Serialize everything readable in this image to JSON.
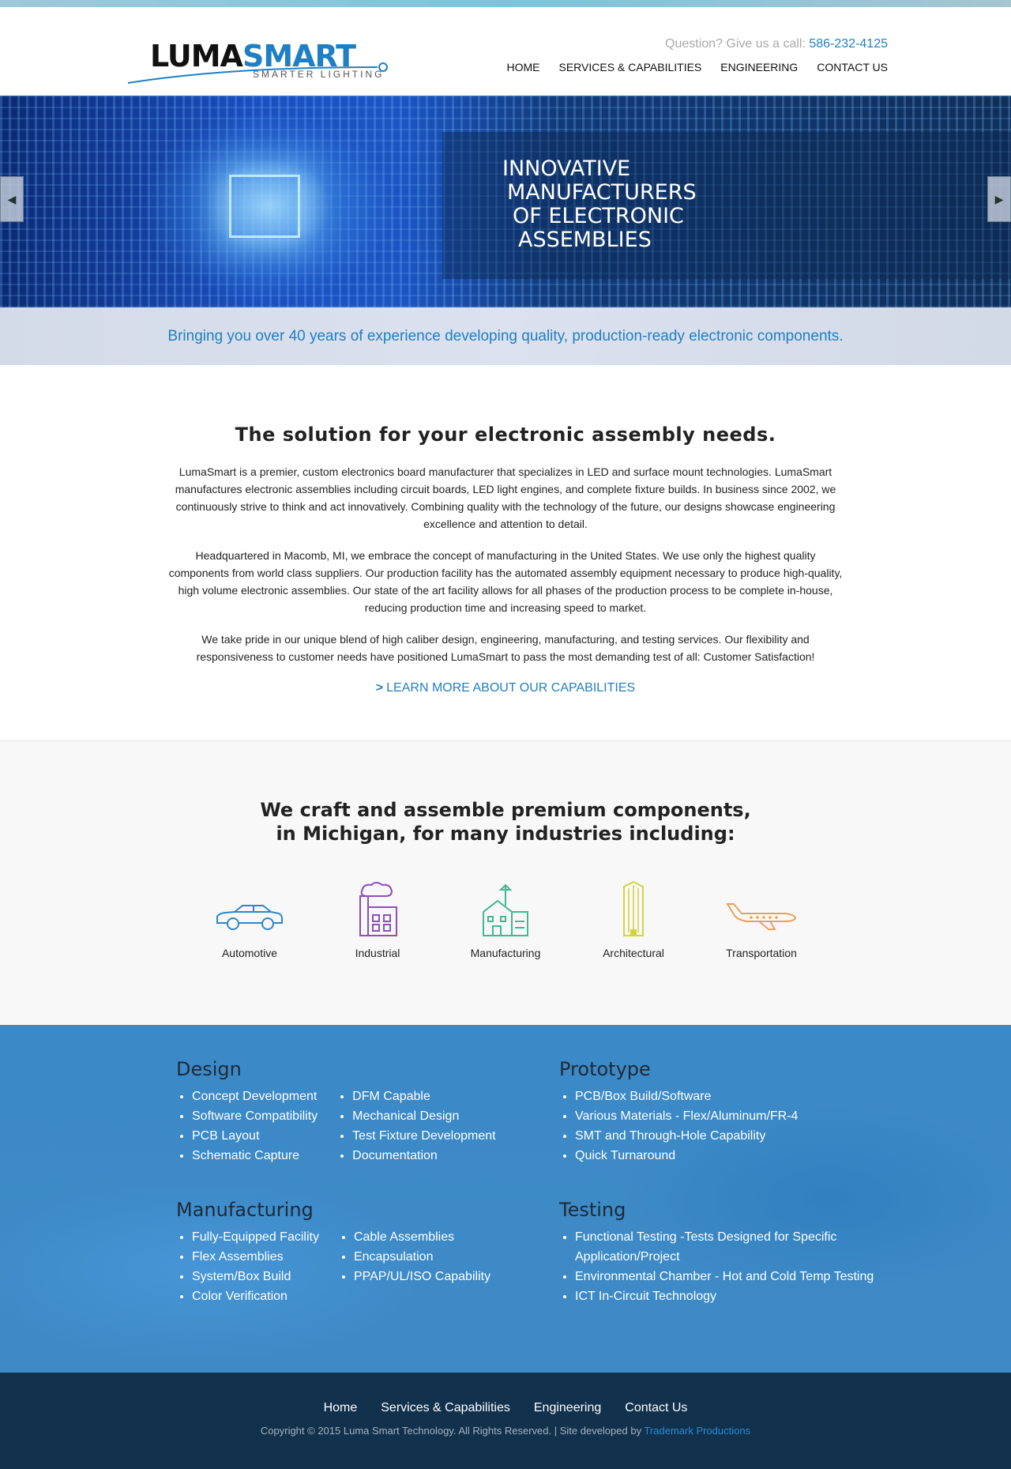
{
  "header": {
    "logo": {
      "luma": "LUMA",
      "smart": "SMART",
      "tagline": "SMARTER LIGHTING"
    },
    "phone_prefix": "Question? Give us a call:",
    "phone_number": "586-232-4125",
    "nav": [
      "HOME",
      "SERVICES & CAPABILITIES",
      "ENGINEERING",
      "CONTACT US"
    ]
  },
  "hero": {
    "lines": [
      "INNOVATIVE",
      "MANUFACTURERS",
      "OF ELECTRONIC",
      "ASSEMBLIES"
    ],
    "prev_icon": "triangle-left-icon",
    "next_icon": "triangle-right-icon"
  },
  "tagline": "Bringing you over 40 years of experience developing quality, production-ready electronic components.",
  "intro": {
    "heading": "The solution for your electronic assembly needs.",
    "paragraphs": [
      "LumaSmart is a premier, custom electronics board manufacturer that specializes in LED and surface mount technologies. LumaSmart manufactures electronic assemblies including circuit boards, LED light engines, and complete fixture builds. In business since 2002, we continuously strive to think and act innovatively. Combining quality with the technology of the future, our designs showcase engineering excellence and attention to detail.",
      "Headquartered in Macomb, MI, we embrace the concept of manufacturing in the United States. We use only the highest quality components from world class suppliers. Our production facility has the automated assembly equipment necessary to produce high-quality, high volume electronic assemblies. Our state of the art facility allows for all phases of the production process to be complete in-house, reducing production time and increasing speed to market.",
      "We take pride in our unique blend of high caliber design, engineering, manufacturing, and testing services. Our flexibility and responsiveness to customer needs have positioned LumaSmart to pass the most demanding test of all: Customer Satisfaction!"
    ],
    "learn_more_prefix": ">",
    "learn_more": "LEARN MORE ABOUT OUR CAPABILITIES"
  },
  "industries": {
    "heading_line1": "We craft and assemble premium components,",
    "heading_line2": "in Michigan, for many industries including:",
    "items": [
      {
        "label": "Automotive",
        "icon": "car-icon",
        "color": "#2f86c8"
      },
      {
        "label": "Industrial",
        "icon": "factory-icon",
        "color": "#8e4fb7"
      },
      {
        "label": "Manufacturing",
        "icon": "building-icon",
        "color": "#3fb894"
      },
      {
        "label": "Architectural",
        "icon": "skyscraper-icon",
        "color": "#d4d43a"
      },
      {
        "label": "Transportation",
        "icon": "airplane-icon",
        "color": "#e8a25a"
      }
    ]
  },
  "services": {
    "design": {
      "title": "Design",
      "col1": [
        "Concept Development",
        "Software Compatibility",
        "PCB Layout",
        "Schematic Capture"
      ],
      "col2": [
        "DFM Capable",
        "Mechanical Design",
        "Test Fixture Development",
        "Documentation"
      ]
    },
    "prototype": {
      "title": "Prototype",
      "items": [
        "PCB/Box Build/Software",
        "Various Materials - Flex/Aluminum/FR-4",
        "SMT and Through-Hole Capability",
        "Quick Turnaround"
      ]
    },
    "manufacturing": {
      "title": "Manufacturing",
      "col1": [
        "Fully-Equipped Facility",
        "Flex Assemblies",
        "System/Box Build",
        "Color Verification"
      ],
      "col2": [
        "Cable Assemblies",
        "Encapsulation",
        "PPAP/UL/ISO Capability"
      ]
    },
    "testing": {
      "title": "Testing",
      "items": [
        "Functional Testing -Tests Designed for Specific Application/Project",
        "Environmental Chamber - Hot and Cold Temp Testing",
        "ICT In-Circuit Technology"
      ]
    }
  },
  "footer": {
    "nav": [
      "Home",
      "Services & Capabilities",
      "Engineering",
      "Contact Us"
    ],
    "copyright": "Copyright © 2015 Luma Smart Technology. All Rights Reserved. | Site developed by",
    "developer": "Trademark Productions"
  },
  "colors": {
    "accent": "#1f7fc4",
    "footer_bg": "#11314c",
    "services_bg": "#3d8ac6"
  }
}
